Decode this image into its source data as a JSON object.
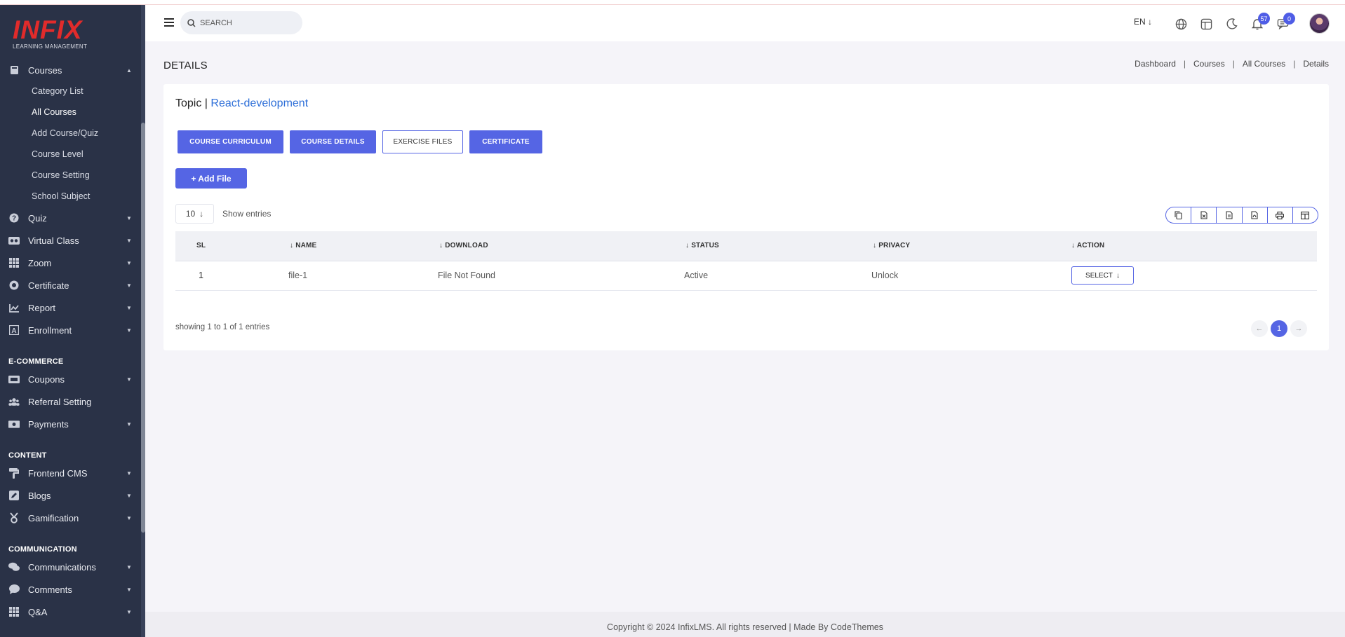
{
  "app": {
    "brand": "INFIX",
    "brand_sub": "LEARNING MANAGEMENT"
  },
  "sidebar": {
    "courses": {
      "label": "Courses",
      "icon": "book-icon"
    },
    "course_subitems": [
      {
        "label": "Category List"
      },
      {
        "label": "All Courses"
      },
      {
        "label": "Add Course/Quiz"
      },
      {
        "label": "Course Level"
      },
      {
        "label": "Course Setting"
      },
      {
        "label": "School Subject"
      }
    ],
    "items": [
      {
        "label": "Quiz",
        "icon": "question-circle-icon"
      },
      {
        "label": "Virtual Class",
        "icon": "vr-headset-icon"
      },
      {
        "label": "Zoom",
        "icon": "grid-icon"
      },
      {
        "label": "Certificate",
        "icon": "badge-icon"
      },
      {
        "label": "Report",
        "icon": "chart-icon"
      },
      {
        "label": "Enrollment",
        "icon": "font-box-icon"
      }
    ],
    "ecommerce_heading": "E-COMMERCE",
    "ecommerce": [
      {
        "label": "Coupons",
        "icon": "ticket-icon"
      },
      {
        "label": "Referral Setting",
        "icon": "users-icon"
      },
      {
        "label": "Payments",
        "icon": "money-icon"
      }
    ],
    "content_heading": "CONTENT",
    "content": [
      {
        "label": "Frontend CMS",
        "icon": "paint-roller-icon"
      },
      {
        "label": "Blogs",
        "icon": "edit-icon"
      },
      {
        "label": "Gamification",
        "icon": "medal-icon"
      }
    ],
    "communication_heading": "COMMUNICATION",
    "communication": [
      {
        "label": "Communications",
        "icon": "chat-icon"
      },
      {
        "label": "Comments",
        "icon": "comment-icon"
      },
      {
        "label": "Q&A",
        "icon": "grid-icon"
      }
    ]
  },
  "header": {
    "search_placeholder": "SEARCH",
    "language": "EN",
    "notifications_count": "57",
    "messages_count": "0"
  },
  "page": {
    "title": "DETAILS",
    "breadcrumb": [
      "Dashboard",
      "Courses",
      "All Courses",
      "Details"
    ]
  },
  "card": {
    "topic_prefix": "Topic |",
    "topic_name": "React-development",
    "tabs": [
      "COURSE CURRICULUM",
      "COURSE DETAILS",
      "EXERCISE FILES",
      "CERTIFICATE"
    ],
    "add_button": "+ Add File",
    "page_length": "10",
    "show_entries": "Show entries"
  },
  "table": {
    "columns": [
      "SL",
      "NAME",
      "DOWNLOAD",
      "STATUS",
      "PRIVACY",
      "ACTION"
    ],
    "rows": [
      {
        "sl": "1",
        "name": "file-1",
        "download": "File Not Found",
        "status": "Active",
        "privacy": "Unlock",
        "action": "SELECT"
      }
    ],
    "summary": "showing 1 to 1 of 1 entries",
    "current_page": "1"
  },
  "footer": {
    "text": "Copyright © 2024 InfixLMS. All rights reserved | Made By CodeThemes"
  },
  "colors": {
    "primary": "#5565e4",
    "sidebar": "#2a3247",
    "brand": "#e12b2b"
  }
}
